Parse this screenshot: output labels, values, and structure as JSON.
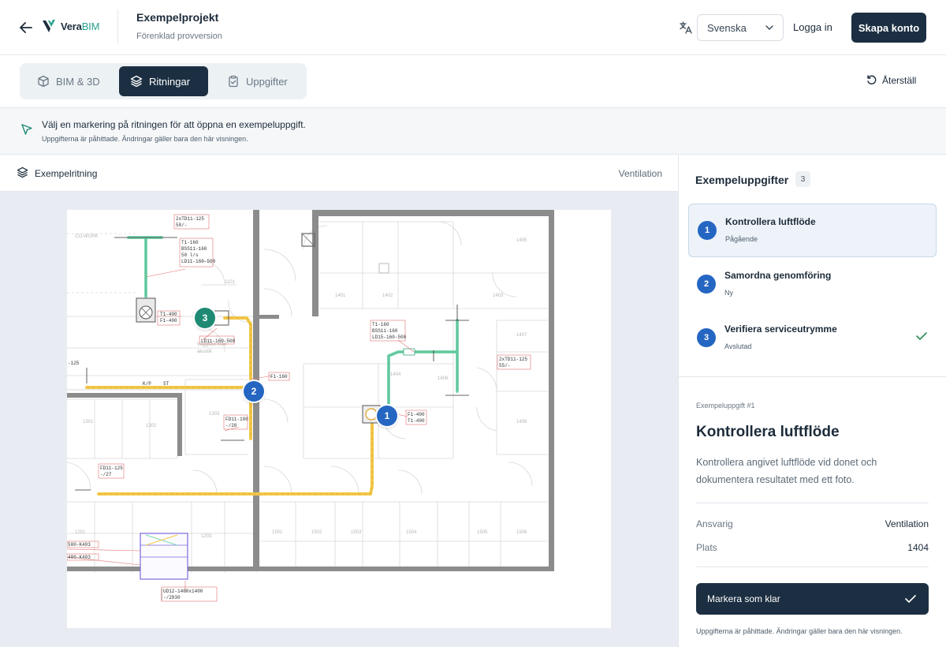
{
  "header": {
    "logo_main": "Vera",
    "logo_accent": "BIM",
    "project_title": "Exempelprojekt",
    "project_subtitle": "Förenklad provversion",
    "language": "Svenska",
    "login_label": "Logga in",
    "create_account_label": "Skapa konto"
  },
  "tabs": [
    {
      "label": "BIM & 3D",
      "icon": "cube-icon",
      "active": false
    },
    {
      "label": "Ritningar",
      "icon": "layers-icon",
      "active": true
    },
    {
      "label": "Uppgifter",
      "icon": "clipboard-icon",
      "active": false
    }
  ],
  "reset_label": "Återställ",
  "banner": {
    "main": "Välj en markering på ritningen för att öppna en exempeluppgift.",
    "sub": "Uppgifterna är påhittade. Ändringar gäller bara den här visningen."
  },
  "drawing": {
    "title": "Exempelritning",
    "discipline": "Ventilation",
    "plan_labels": {
      "l1": "2xTD11-125",
      "l2": "50/-",
      "l3": "T1-160",
      "l4": "BSS11-160",
      "l5": "50 l/s",
      "l6": "LD11-160-500",
      "l7": "T1-400",
      "l8": "F1-400",
      "l9": "LD11-160-500",
      "l10": "F1-160",
      "l11": "FD11-100",
      "l12": "-/20",
      "l13": "FD11-125",
      "l14": "-/27",
      "l15": "T1-160",
      "l16": "BSS11-160",
      "l17": "LD15-160-500",
      "l18": "F1-400",
      "l19": "T1-400",
      "l20": "2xTD11-125",
      "l21": "55/-",
      "l22": "UD12-1400x1400",
      "l23": "-/2830",
      "l24": "500-K403",
      "l25": "400-K403",
      "l26": "-125",
      "l27": "K/P",
      "l28": "ST"
    },
    "markers": [
      {
        "number": "1",
        "color": "#2566c2"
      },
      {
        "number": "2",
        "color": "#2566c2"
      },
      {
        "number": "3",
        "color": "#1f8a74"
      }
    ]
  },
  "tasks_panel": {
    "title": "Exempeluppgifter",
    "count": "3",
    "tasks": [
      {
        "number": "1",
        "title": "Kontrollera luftflöde",
        "status": "Pågående",
        "done": false
      },
      {
        "number": "2",
        "title": "Samordna genomföring",
        "status": "Ny",
        "done": false
      },
      {
        "number": "3",
        "title": "Verifiera serviceutrymme",
        "status": "Avslutad",
        "done": true
      }
    ]
  },
  "detail": {
    "kicker": "Exempeluppgift #1",
    "title": "Kontrollera luftflöde",
    "description": "Kontrollera angivet luftflöde vid donet och dokumentera resultatet med ett foto.",
    "responsible_label": "Ansvarig",
    "responsible_value": "Ventilation",
    "location_label": "Plats",
    "location_value": "1404",
    "done_button_label": "Markera som klar",
    "footnote": "Uppgifterna är påhittade. Ändringar gäller bara den här visningen."
  },
  "colors": {
    "primary": "#1c2f42",
    "marker_blue": "#2566c2",
    "marker_teal": "#1f8a74",
    "check_green": "#2f8a5a",
    "duct_yellow": "#f3c84a",
    "duct_green": "#7fd9b2"
  }
}
